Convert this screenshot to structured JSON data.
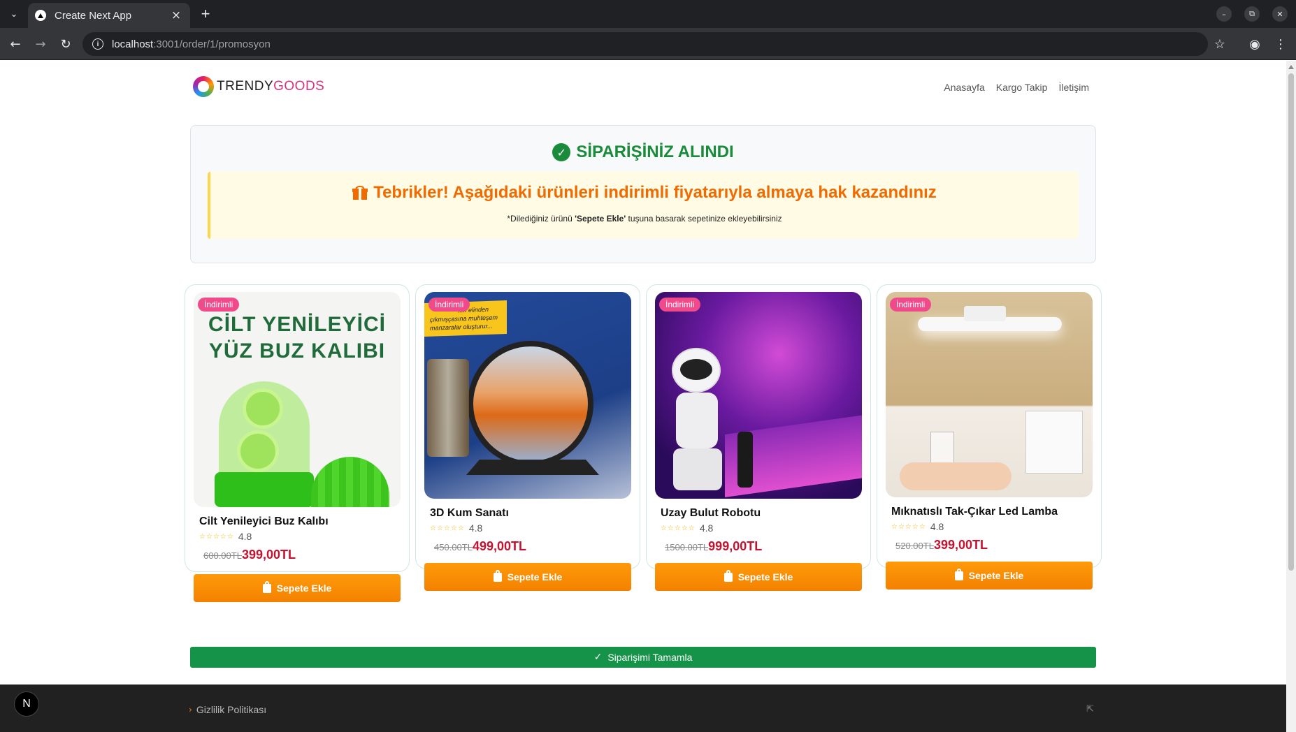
{
  "browser": {
    "tab_title": "Create Next App",
    "url_host": "localhost",
    "url_path": ":3001/order/1/promosyon"
  },
  "header": {
    "logo_part1": "TRENDY",
    "logo_part2": "GOODS",
    "nav": [
      "Anasayfa",
      "Kargo Takip",
      "İletişim"
    ]
  },
  "success": {
    "title": "SİPARİŞİNİZ ALINDI",
    "promo_title": "Tebrikler! Aşağıdaki ürünleri indirimli fiyatarıyla almaya hak kazandınız",
    "note_prefix": "*Dilediğiniz ürünü ",
    "note_bold": "'Sepete Ekle'",
    "note_suffix": " tuşuna basarak sepetinize ekleyebilirsiniz"
  },
  "products": [
    {
      "badge": "İndirimli",
      "name": "Cilt Yenileyici Buz Kalıbı",
      "rating": "4.8",
      "old_price": "600.00TL",
      "new_price": "399,00TL",
      "button": "Sepete Ekle",
      "image_text_1": "CİLT YENİLEYİCİ",
      "image_text_2": "YÜZ BUZ KALIBI"
    },
    {
      "badge": "İndirimli",
      "name": "3D Kum Sanatı",
      "rating": "4.8",
      "old_price": "450.00TL",
      "new_price": "499,00TL",
      "button": "Sepete Ekle",
      "image_text_1": "...n elinden",
      "image_text_2": "çıkmışçasına muhteşem manzaralar oluşturur..."
    },
    {
      "badge": "İndirimli",
      "name": "Uzay Bulut Robotu",
      "rating": "4.8",
      "old_price": "1500.00TL",
      "new_price": "999,00TL",
      "button": "Sepete Ekle"
    },
    {
      "badge": "İndirimli",
      "name": "Mıknatıslı Tak-Çıkar Led Lamba",
      "rating": "4.8",
      "old_price": "520.00TL",
      "new_price": "399,00TL",
      "button": "Sepete Ekle"
    }
  ],
  "complete_button": "Siparişimi Tamamla",
  "footer": {
    "link": "Gizlilik Politikası",
    "next_badge": "N"
  }
}
